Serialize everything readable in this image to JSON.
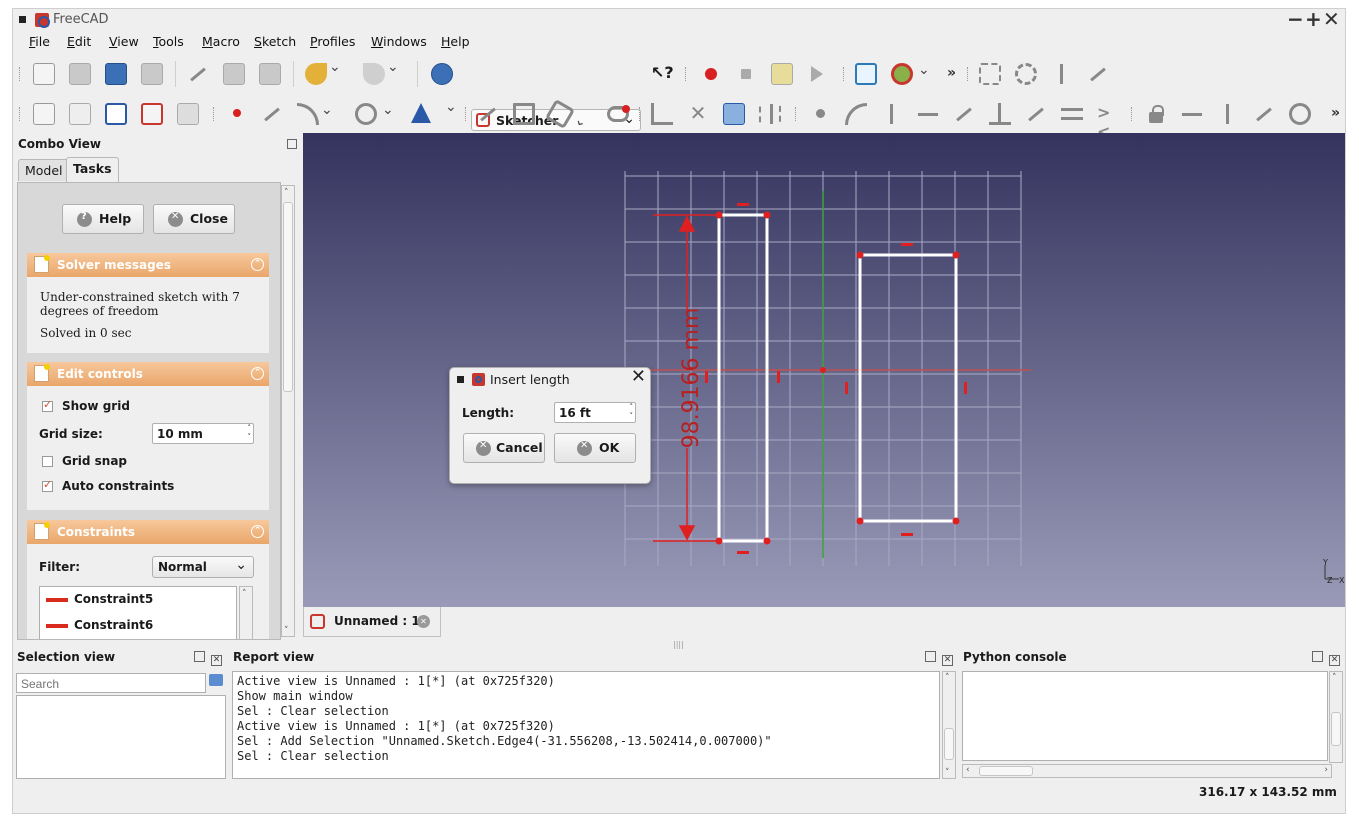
{
  "window": {
    "title": "FreeCAD"
  },
  "menu": [
    "File",
    "Edit",
    "View",
    "Tools",
    "Macro",
    "Sketch",
    "Profiles",
    "Windows",
    "Help"
  ],
  "workbench": {
    "selected": "Sketcher"
  },
  "combo_view": {
    "title": "Combo View",
    "tabs": [
      "Model",
      "Tasks"
    ],
    "active_tab": "Tasks",
    "help_label": "Help",
    "close_label": "Close",
    "solver": {
      "title": "Solver messages",
      "message": "Under-constrained sketch with 7 degrees of freedom",
      "solved": "Solved in 0 sec"
    },
    "edit_controls": {
      "title": "Edit controls",
      "show_grid_label": "Show grid",
      "show_grid": true,
      "grid_size_label": "Grid size:",
      "grid_size": "10 mm",
      "grid_snap_label": "Grid snap",
      "grid_snap": false,
      "auto_constraints_label": "Auto constraints",
      "auto_constraints": true
    },
    "constraints": {
      "title": "Constraints",
      "filter_label": "Filter:",
      "filter_value": "Normal",
      "items": [
        "Constraint5",
        "Constraint6"
      ],
      "item_color": "#d92a1e"
    }
  },
  "view3d": {
    "dimension_label": "98.9166 mm",
    "accent_sketch": "#ffffff",
    "accent_constraint": "#e02020",
    "axis_vertical": "#3aa63a",
    "axis_horizontal": "#c05050"
  },
  "dialog": {
    "title": "Insert length",
    "length_label": "Length:",
    "length_value": "16 ft",
    "cancel_label": "Cancel",
    "ok_label": "OK"
  },
  "doc_tab": {
    "label": "Unnamed : 1*"
  },
  "selection_view": {
    "title": "Selection view",
    "search_placeholder": "Search"
  },
  "report_view": {
    "title": "Report view",
    "lines": [
      "Active view is Unnamed : 1[*] (at 0x725f320)",
      "Show main window",
      "Sel : Clear selection",
      "Active view is Unnamed : 1[*] (at 0x725f320)",
      "Sel : Add Selection \"Unnamed.Sketch.Edge4(-31.556208,-13.502414,0.007000)\"",
      "Sel : Clear selection"
    ]
  },
  "python_console": {
    "title": "Python console"
  },
  "status": {
    "dimensions": "316.17 x 143.52 mm"
  }
}
